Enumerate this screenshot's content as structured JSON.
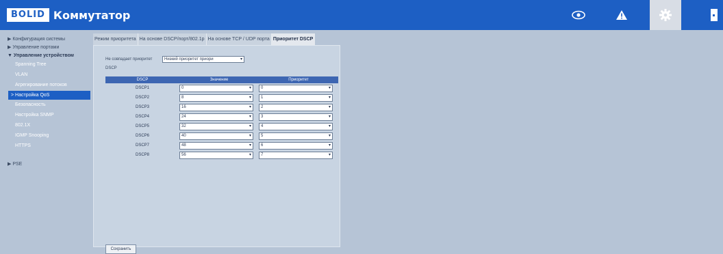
{
  "header": {
    "logo": "BOLID",
    "title": "Коммутатор"
  },
  "sidebar": {
    "items": [
      {
        "label": "▶ Конфигурация системы"
      },
      {
        "label": "▶ Управление портами"
      },
      {
        "label": "▼ Управление устройством"
      }
    ],
    "sub_items": [
      {
        "label": "Spanning Tree"
      },
      {
        "label": "VLAN"
      },
      {
        "label": "Агрегирование потоков"
      },
      {
        "label": "Настройка QoS"
      },
      {
        "label": "Безопасность"
      },
      {
        "label": "Настройка SNMP"
      },
      {
        "label": "802.1X"
      },
      {
        "label": "IGMP Snooping"
      },
      {
        "label": "HTTPS"
      }
    ],
    "poe": "▶ PSE"
  },
  "tabs": [
    {
      "label": "Режим приоритета"
    },
    {
      "label": "На основе DSCP/порт/802.1p"
    },
    {
      "label": "На основе TCP / UDP порта"
    },
    {
      "label": "Приоритет DSCP"
    }
  ],
  "form": {
    "priority_label": "Не совпадает приоритет",
    "priority_value": "Низкий приоритет приори",
    "dscp_label": "DSCP"
  },
  "table": {
    "headers": [
      "DSCP",
      "Значение",
      "Приоритет"
    ],
    "rows": [
      {
        "name": "DSCP1",
        "value": "0",
        "priority": "0"
      },
      {
        "name": "DSCP2",
        "value": "8",
        "priority": "1"
      },
      {
        "name": "DSCP3",
        "value": "16",
        "priority": "2"
      },
      {
        "name": "DSCP4",
        "value": "24",
        "priority": "3"
      },
      {
        "name": "DSCP5",
        "value": "32",
        "priority": "4"
      },
      {
        "name": "DSCP6",
        "value": "40",
        "priority": "5"
      },
      {
        "name": "DSCP7",
        "value": "48",
        "priority": "6"
      },
      {
        "name": "DSCP8",
        "value": "56",
        "priority": "7"
      }
    ]
  },
  "buttons": {
    "save": "Сохранить"
  },
  "icons": {
    "eye": "eye-icon",
    "alert": "warning-icon",
    "settings": "gear-icon",
    "logout": "logout-icon"
  },
  "colors": {
    "brand": "#1d5fc4",
    "table_header": "#3d66b2"
  }
}
